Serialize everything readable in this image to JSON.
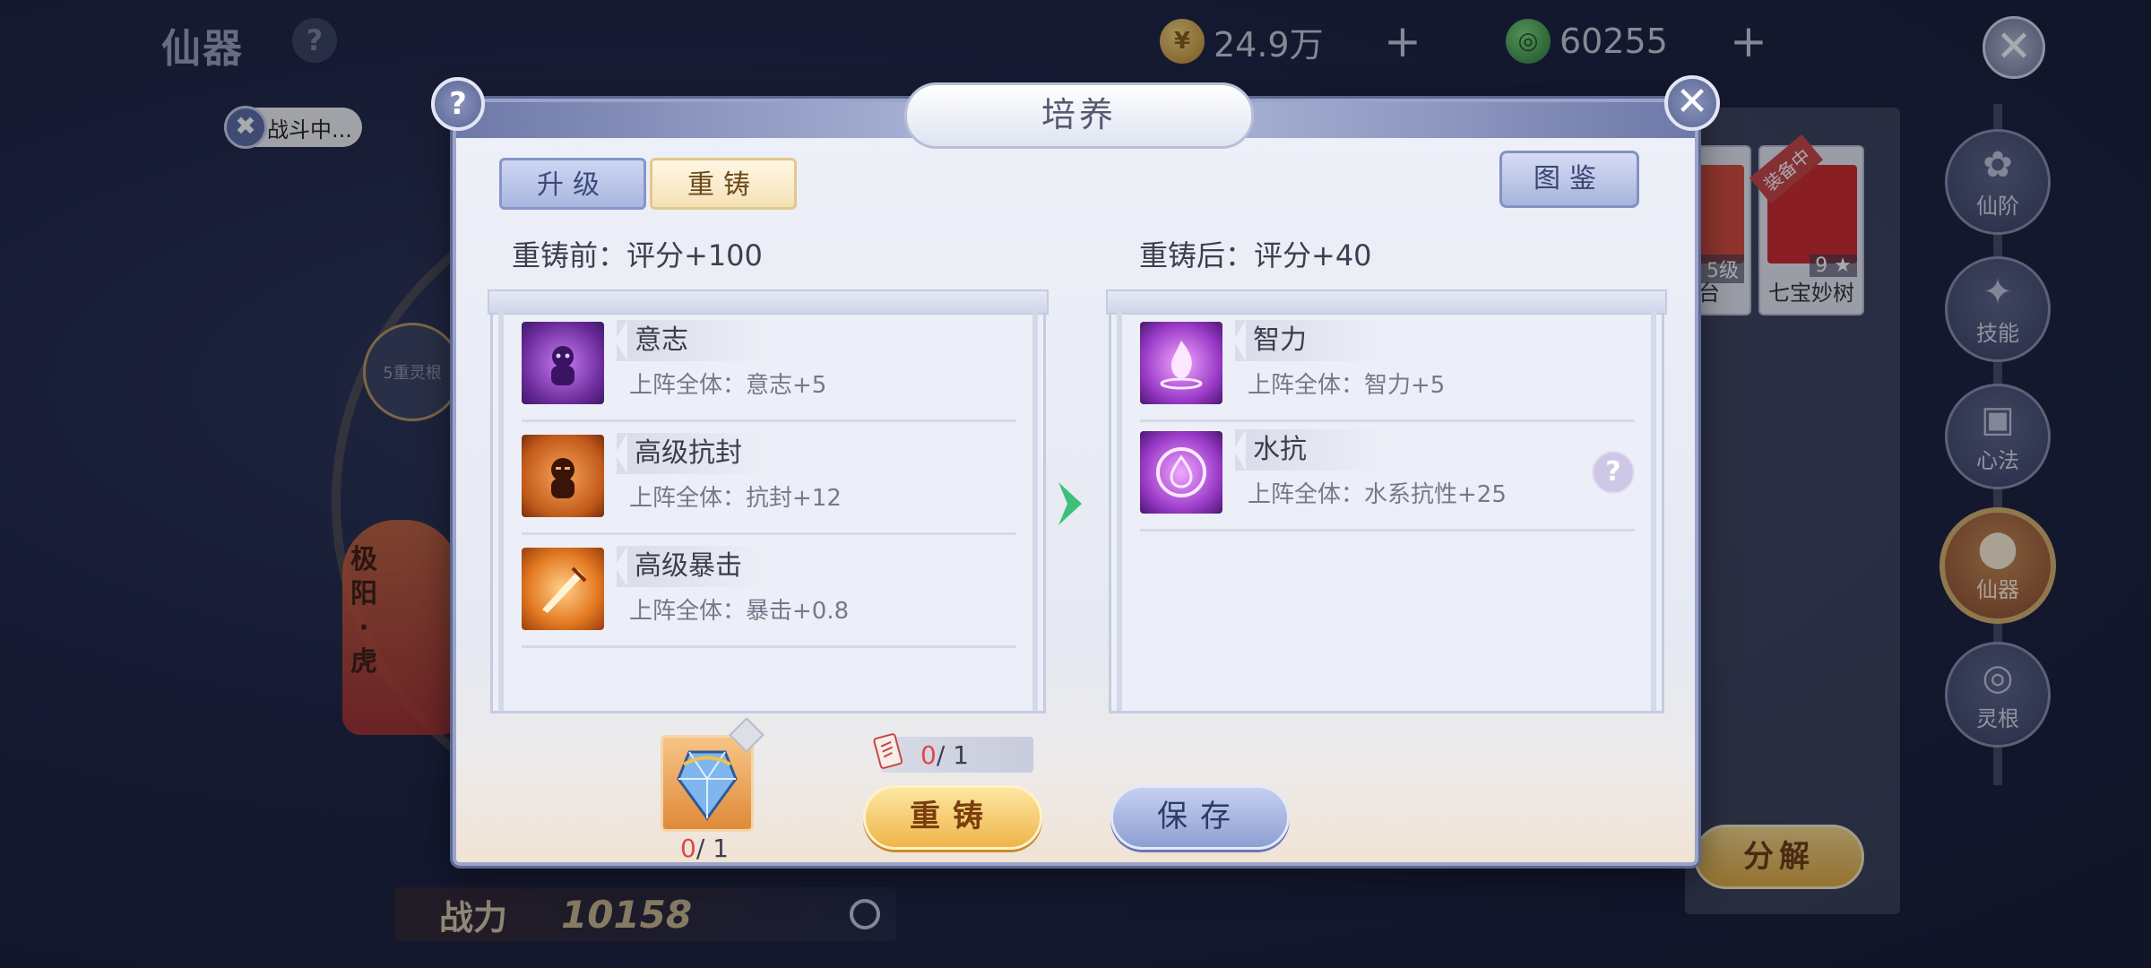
{
  "header": {
    "title": "仙器",
    "help_glyph": "?",
    "currencies": [
      {
        "icon": "gold-coin-icon",
        "amount": "24.9万",
        "add": "+"
      },
      {
        "icon": "jade-coin-icon",
        "amount": "60255",
        "add": "+"
      }
    ],
    "close_glyph": "✕"
  },
  "battle_status": {
    "label": "战斗中..."
  },
  "left_area": {
    "node_label": "5重灵根",
    "banner_text": "极阳·虎"
  },
  "power": {
    "label": "战力",
    "value": "10158"
  },
  "right_area": {
    "items": [
      {
        "level": "5级",
        "name": "莲台"
      },
      {
        "level": "9 ★",
        "name": "七宝妙树",
        "badge": "装备中"
      }
    ],
    "decompose_label": "分解"
  },
  "nav": [
    {
      "label": "仙阶",
      "icon": "flower-icon",
      "active": false
    },
    {
      "label": "技能",
      "icon": "skill-icon",
      "active": false
    },
    {
      "label": "心法",
      "icon": "scroll-icon",
      "active": false
    },
    {
      "label": "仙器",
      "icon": "artifact-icon",
      "active": true
    },
    {
      "label": "灵根",
      "icon": "spirit-root-icon",
      "active": false
    }
  ],
  "modal": {
    "title": "培养",
    "help_glyph": "?",
    "close_glyph": "✕",
    "tabs": [
      {
        "label": "升级",
        "active": false
      },
      {
        "label": "重铸",
        "active": true
      }
    ],
    "codex_label": "图鉴",
    "before": {
      "label": "重铸前：评分+100",
      "attributes": [
        {
          "name": "意志",
          "desc": "上阵全体：意志+5",
          "icon": "willpower-icon"
        },
        {
          "name": "高级抗封",
          "desc": "上阵全体：抗封+12",
          "icon": "seal-resist-icon"
        },
        {
          "name": "高级暴击",
          "desc": "上阵全体：暴击+0.8",
          "icon": "critical-strike-icon"
        }
      ]
    },
    "after": {
      "label": "重铸后：评分+40",
      "attributes": [
        {
          "name": "智力",
          "desc": "上阵全体：智力+5",
          "icon": "intelligence-icon"
        },
        {
          "name": "水抗",
          "desc": "上阵全体：水系抗性+25",
          "icon": "water-resist-icon"
        }
      ]
    },
    "material": {
      "owned": "0",
      "required": "/ 1"
    },
    "scroll": {
      "owned": "0",
      "required": "/ 1"
    },
    "reforge_label": "重铸",
    "save_label": "保存",
    "attr_help_glyph": "?"
  }
}
